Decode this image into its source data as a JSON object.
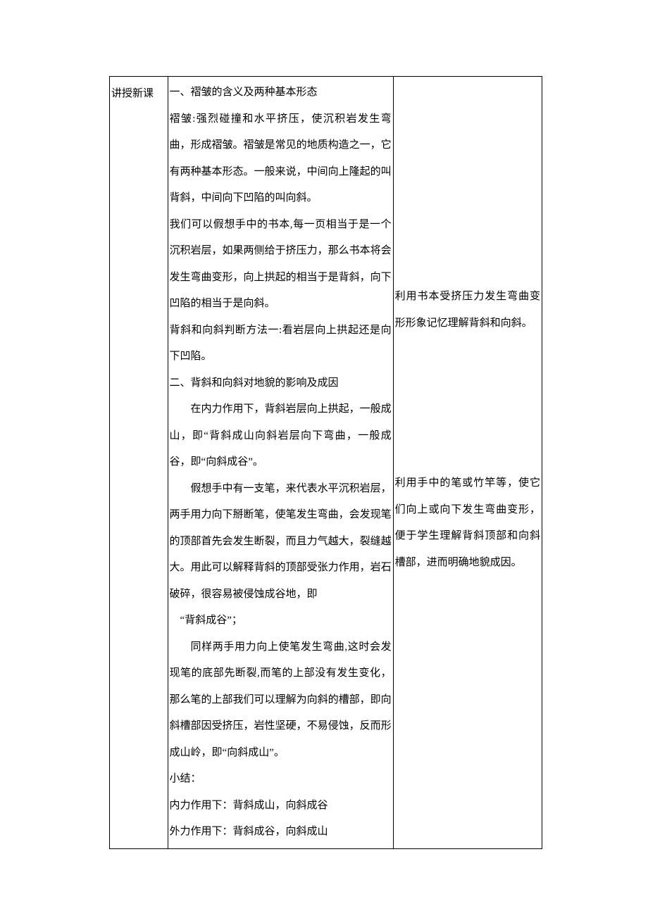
{
  "col1": {
    "label": "讲授新课"
  },
  "col2": {
    "s1_title": "一、褶皱的含义及两种基本形态",
    "s1_p1": "褶皱:强烈碰撞和水平挤压，使沉积岩发生弯曲，形成褶皱。褶皱是常见的地质构造之一，它有两种基本形态。一般来说，中间向上隆起的叫背斜，中间向下凹陷的叫向斜。",
    "s1_p2": "我们可以假想手中的书本,每一页相当于是一个沉积岩层，如果两侧给于挤压力，那么书本将会发生弯曲变形，向上拱起的相当于是背斜，向下凹陷的相当于是向斜。",
    "s1_p3": "背斜和向斜判断方法一:看岩层向上拱起还是向下凹陷。",
    "s2_title": "二、背斜和向斜对地貌的影响及成因",
    "s2_p1": "在内力作用下，背斜岩层向上拱起，一般成山，即“背斜成山向斜岩层向下弯曲，一般成谷，即“向斜成谷”。",
    "s2_p2": "假想手中有一支笔，来代表水平沉积岩层，两手用力向下掰断笔，使笔发生弯曲，会发现笔的顶部首先会发生断裂，而且力气越大，裂缝越大。用此可以解释背斜的顶部受张力作用，岩石破碎，很容易被侵蚀成谷地，即",
    "s2_p2b": "“背斜成谷”；",
    "s2_p3": "同样两手用力向上使笔发生弯曲,这时会发现笔的底部先断裂,而笔的上部没有发生变化，那么笔的上部我们可以理解为向斜的槽部，即向斜槽部因受挤压，岩性坚硬，不易侵蚀，反而形成山岭，即“向斜成山”。",
    "s2_sum_label": "小结：",
    "s2_sum1": "内力作用下：背斜成山，向斜成谷",
    "s2_sum2": "外力作用下：背斜成谷，向斜成山"
  },
  "col3": {
    "n1": "利用书本受挤压力发生弯曲变形形象记忆理解背斜和向斜。",
    "n2": "利用手中的笔或竹竿等，使它们向上或向下发生弯曲变形，便于学生理解背斜顶部和向斜槽部，进而明确地貌成因。"
  }
}
